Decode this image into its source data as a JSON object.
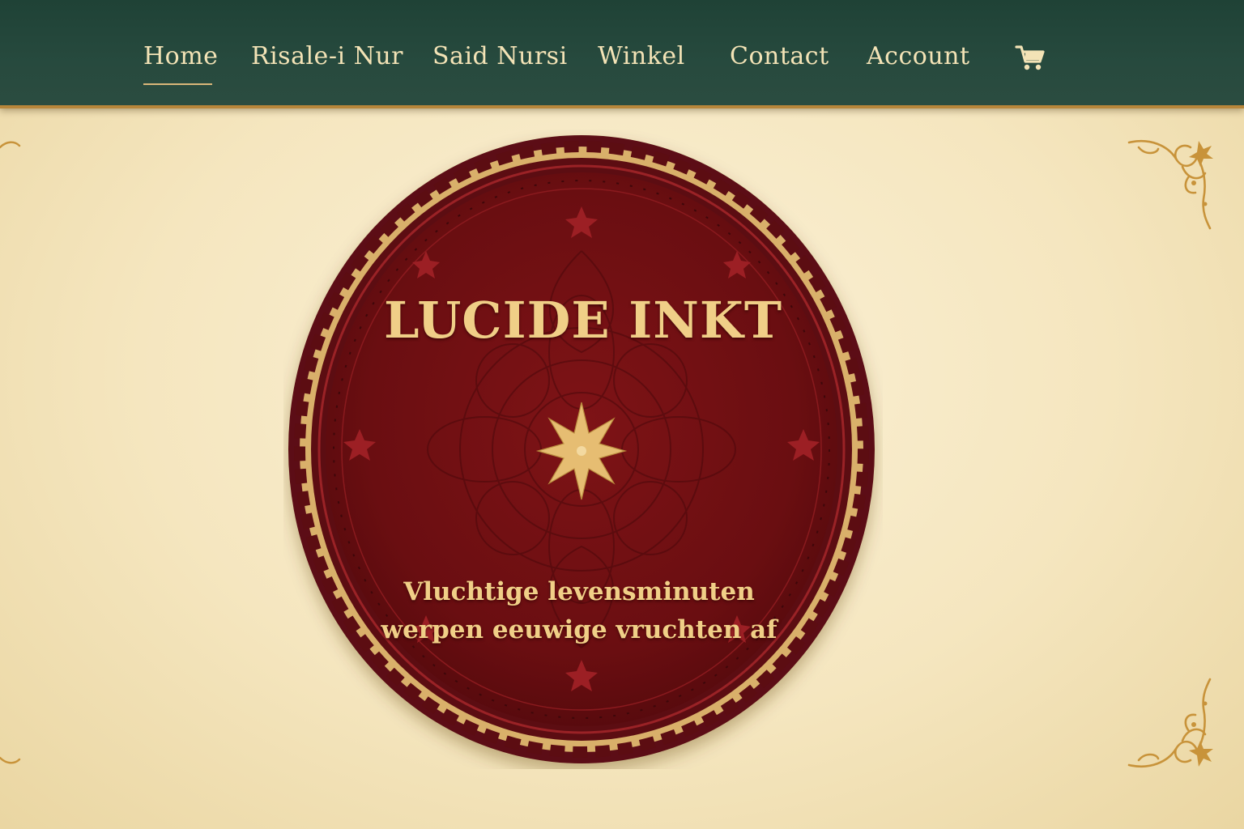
{
  "nav": {
    "items": [
      {
        "label": "Home",
        "active": true
      },
      {
        "label": "Risale-i Nur",
        "active": false
      },
      {
        "label": "Said Nursi",
        "active": false
      },
      {
        "label": "Winkel",
        "active": false
      },
      {
        "label": "Contact",
        "active": false
      },
      {
        "label": "Account",
        "active": false
      }
    ],
    "cart_icon": "shopping-cart-icon"
  },
  "hero": {
    "title": "LUCIDE INKT",
    "tagline_line1": "Vluchtige levensminuten",
    "tagline_line2": "werpen eeuwige vruchten af",
    "center_icon": "eight-pointed-star-icon"
  },
  "colors": {
    "nav_background": "#274a3e",
    "nav_text": "#f3e3b6",
    "accent_gold": "#d8b46a",
    "seal_red": "#6e0f12",
    "parchment": "#f5e6bf"
  }
}
